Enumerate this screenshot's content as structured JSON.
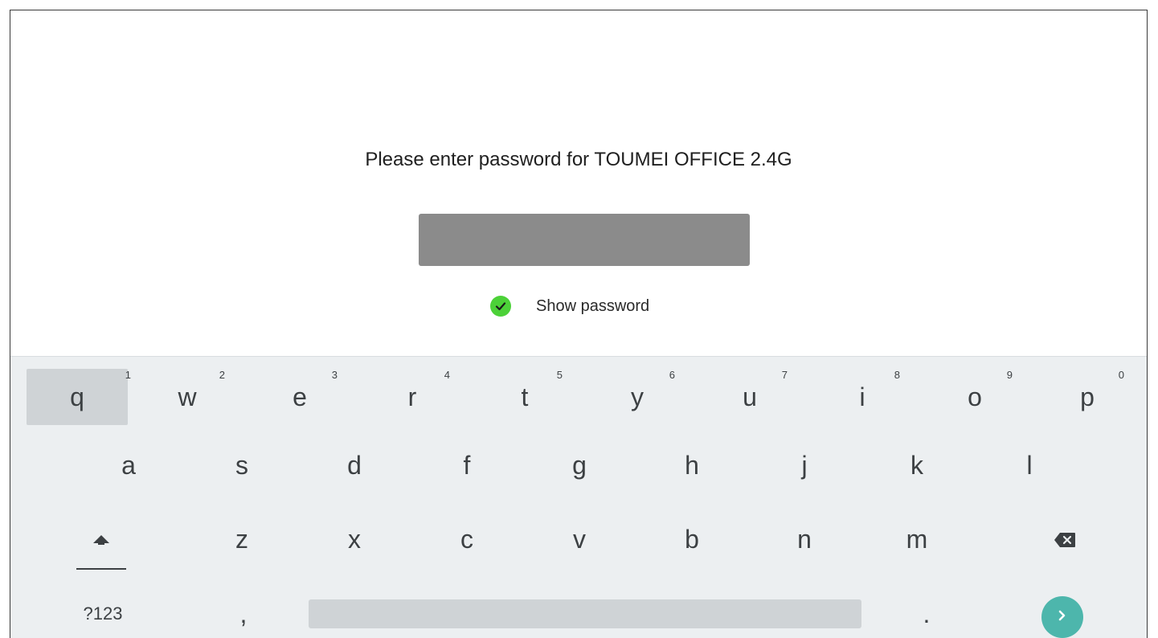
{
  "dialog": {
    "prompt": "Please enter password for TOUMEI OFFICE 2.4G",
    "password_value": "",
    "show_password_label": "Show password",
    "show_password_checked": true
  },
  "keyboard": {
    "row1": [
      {
        "key": "q",
        "hint": "1"
      },
      {
        "key": "w",
        "hint": "2"
      },
      {
        "key": "e",
        "hint": "3"
      },
      {
        "key": "r",
        "hint": "4"
      },
      {
        "key": "t",
        "hint": "5"
      },
      {
        "key": "y",
        "hint": "6"
      },
      {
        "key": "u",
        "hint": "7"
      },
      {
        "key": "i",
        "hint": "8"
      },
      {
        "key": "o",
        "hint": "9"
      },
      {
        "key": "p",
        "hint": "0"
      }
    ],
    "row2": [
      "a",
      "s",
      "d",
      "f",
      "g",
      "h",
      "j",
      "k",
      "l"
    ],
    "row3": [
      "z",
      "x",
      "c",
      "v",
      "b",
      "n",
      "m"
    ],
    "row4": {
      "symbols": "?123",
      "comma": ",",
      "period": "."
    },
    "icons": {
      "shift": "shift-arrow-icon",
      "backspace": "backspace-icon",
      "enter": "enter-arrow-icon"
    },
    "colors": {
      "enter_bg": "#4db6ac",
      "check_green": "#4cd138",
      "keyboard_bg": "#eceff1"
    }
  }
}
